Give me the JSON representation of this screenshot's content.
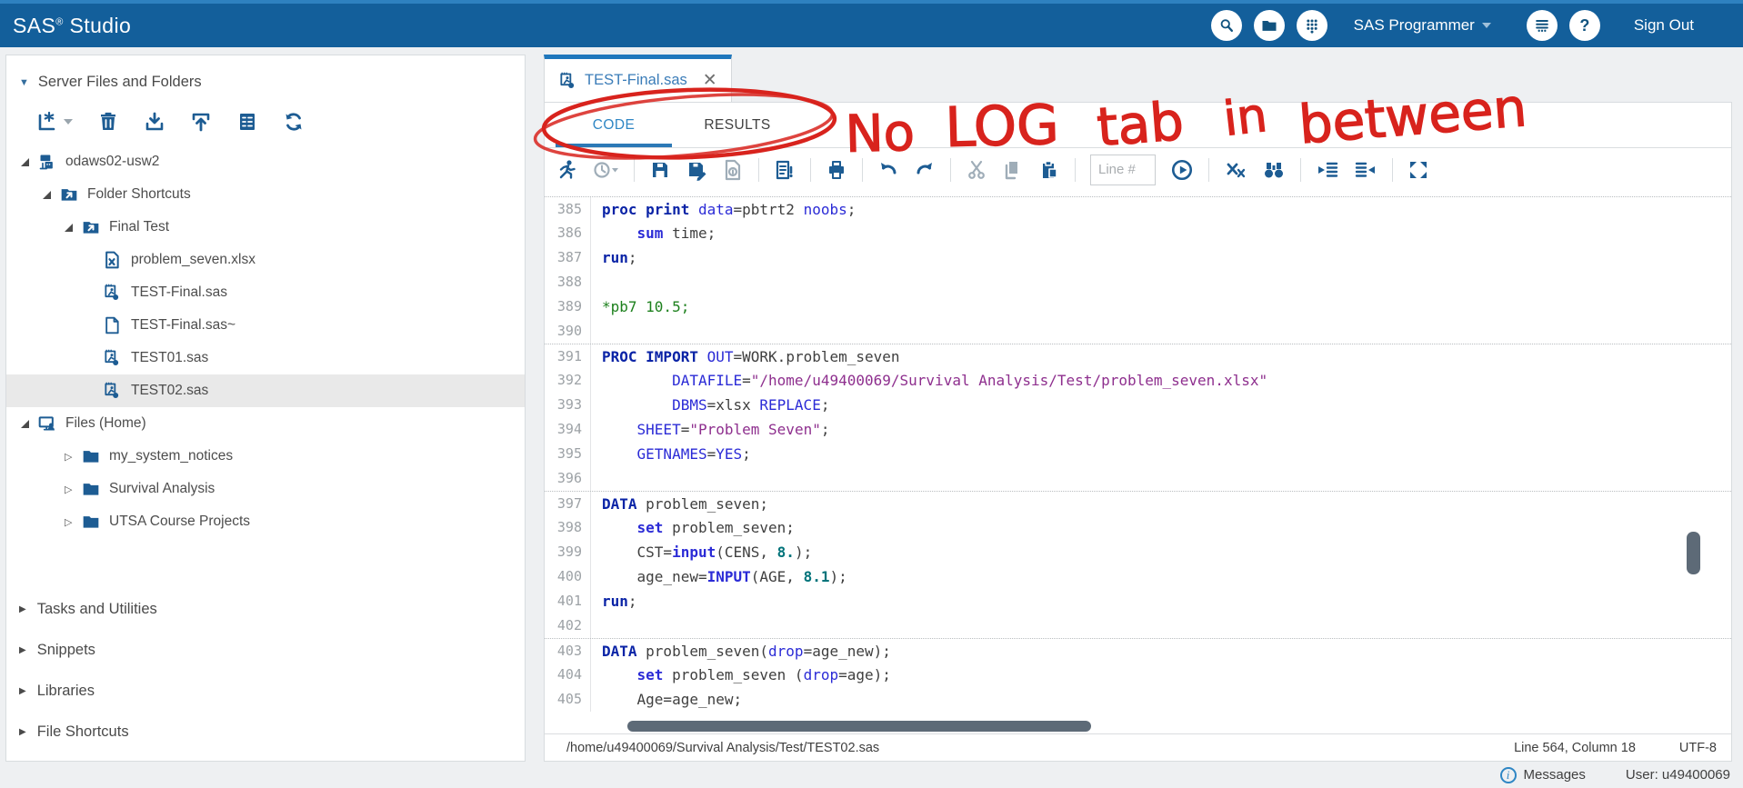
{
  "topbar": {
    "brand_sas": "SAS",
    "brand_reg": "®",
    "brand_studio": " Studio",
    "user_menu": "SAS Programmer",
    "sign_out": "Sign Out",
    "help_glyph": "?"
  },
  "sidebar": {
    "header": "Server Files and Folders",
    "toolbar_icons": [
      "new-item-icon",
      "delete-icon",
      "download-icon",
      "upload-icon",
      "properties-icon",
      "refresh-icon"
    ],
    "tree": [
      {
        "label": "odaws02-usw2",
        "level": 0,
        "caret": "expanded",
        "icon": "server-icon",
        "selected": false
      },
      {
        "label": "Folder Shortcuts",
        "level": 1,
        "caret": "expanded",
        "icon": "shortcut-folder-icon",
        "selected": false
      },
      {
        "label": "Final Test",
        "level": 2,
        "caret": "expanded",
        "icon": "shortcut-folder-icon",
        "selected": false
      },
      {
        "label": "problem_seven.xlsx",
        "level": 3,
        "caret": "none",
        "icon": "excel-file-icon",
        "selected": false
      },
      {
        "label": "TEST-Final.sas",
        "level": 3,
        "caret": "none",
        "icon": "sas-program-icon",
        "selected": false
      },
      {
        "label": "TEST-Final.sas~",
        "level": 3,
        "caret": "none",
        "icon": "file-icon",
        "selected": false
      },
      {
        "label": "TEST01.sas",
        "level": 3,
        "caret": "none",
        "icon": "sas-program-icon",
        "selected": false
      },
      {
        "label": "TEST02.sas",
        "level": 3,
        "caret": "none",
        "icon": "sas-program-icon",
        "selected": true
      },
      {
        "label": "Files (Home)",
        "level": 0,
        "caret": "expanded",
        "icon": "home-files-icon",
        "selected": false
      },
      {
        "label": "my_system_notices",
        "level": 2,
        "caret": "collapsed",
        "icon": "folder-icon",
        "selected": false
      },
      {
        "label": "Survival Analysis",
        "level": 2,
        "caret": "collapsed",
        "icon": "folder-icon",
        "selected": false
      },
      {
        "label": "UTSA Course Projects",
        "level": 2,
        "caret": "collapsed",
        "icon": "folder-icon",
        "selected": false
      }
    ],
    "sections": [
      "Tasks and Utilities",
      "Snippets",
      "Libraries",
      "File Shortcuts"
    ]
  },
  "main": {
    "doc_tab": "TEST-Final.sas",
    "view_tabs": [
      "CODE",
      "RESULTS"
    ],
    "toolbar": {
      "line_input_placeholder": "Line #"
    },
    "editor": {
      "lines": [
        {
          "n": 385,
          "pb": true,
          "seg": [
            [
              "kw",
              "proc print"
            ],
            [
              "pl",
              " "
            ],
            [
              "op",
              "data"
            ],
            [
              "pl",
              "="
            ],
            [
              "pl",
              "pbtrt2 "
            ],
            [
              "op",
              "noobs"
            ],
            [
              "pl",
              ";"
            ]
          ]
        },
        {
          "n": 386,
          "seg": [
            [
              "pl",
              "    "
            ],
            [
              "st",
              "sum"
            ],
            [
              "pl",
              " time;"
            ]
          ]
        },
        {
          "n": 387,
          "seg": [
            [
              "kw",
              "run"
            ],
            [
              "pl",
              ";"
            ]
          ]
        },
        {
          "n": 388,
          "seg": []
        },
        {
          "n": 389,
          "seg": [
            [
              "co",
              "*pb7 10.5;"
            ]
          ]
        },
        {
          "n": 390,
          "seg": []
        },
        {
          "n": 391,
          "pb": true,
          "seg": [
            [
              "kw",
              "PROC IMPORT"
            ],
            [
              "pl",
              " "
            ],
            [
              "op",
              "OUT"
            ],
            [
              "pl",
              "=WORK.problem_seven"
            ]
          ]
        },
        {
          "n": 392,
          "seg": [
            [
              "pl",
              "        "
            ],
            [
              "op",
              "DATAFILE"
            ],
            [
              "pl",
              "="
            ],
            [
              "sr",
              "\"/home/u49400069/Survival Analysis/Test/problem_seven.xlsx\""
            ]
          ]
        },
        {
          "n": 393,
          "seg": [
            [
              "pl",
              "        "
            ],
            [
              "op",
              "DBMS"
            ],
            [
              "pl",
              "=xlsx "
            ],
            [
              "op",
              "REPLACE"
            ],
            [
              "pl",
              ";"
            ]
          ]
        },
        {
          "n": 394,
          "seg": [
            [
              "pl",
              "    "
            ],
            [
              "op",
              "SHEET"
            ],
            [
              "pl",
              "="
            ],
            [
              "sr",
              "\"Problem Seven\""
            ],
            [
              "pl",
              ";"
            ]
          ]
        },
        {
          "n": 395,
          "seg": [
            [
              "pl",
              "    "
            ],
            [
              "op",
              "GETNAMES"
            ],
            [
              "pl",
              "="
            ],
            [
              "op",
              "YES"
            ],
            [
              "pl",
              ";"
            ]
          ]
        },
        {
          "n": 396,
          "seg": []
        },
        {
          "n": 397,
          "pb": true,
          "seg": [
            [
              "kw",
              "DATA"
            ],
            [
              "pl",
              " problem_seven;"
            ]
          ]
        },
        {
          "n": 398,
          "seg": [
            [
              "pl",
              "    "
            ],
            [
              "st",
              "set"
            ],
            [
              "pl",
              " problem_seven;"
            ]
          ]
        },
        {
          "n": 399,
          "seg": [
            [
              "pl",
              "    CST="
            ],
            [
              "st",
              "input"
            ],
            [
              "pl",
              "(CENS, "
            ],
            [
              "nu",
              "8."
            ],
            [
              "pl",
              ");"
            ]
          ]
        },
        {
          "n": 400,
          "seg": [
            [
              "pl",
              "    age_new="
            ],
            [
              "st",
              "INPUT"
            ],
            [
              "pl",
              "(AGE, "
            ],
            [
              "nu",
              "8.1"
            ],
            [
              "pl",
              ");"
            ]
          ]
        },
        {
          "n": 401,
          "seg": [
            [
              "kw",
              "run"
            ],
            [
              "pl",
              ";"
            ]
          ]
        },
        {
          "n": 402,
          "seg": []
        },
        {
          "n": 403,
          "pb": true,
          "seg": [
            [
              "kw",
              "DATA"
            ],
            [
              "pl",
              " problem_seven("
            ],
            [
              "op",
              "drop"
            ],
            [
              "pl",
              "=age_new);"
            ]
          ]
        },
        {
          "n": 404,
          "seg": [
            [
              "pl",
              "    "
            ],
            [
              "st",
              "set"
            ],
            [
              "pl",
              " problem_seven ("
            ],
            [
              "op",
              "drop"
            ],
            [
              "pl",
              "=age);"
            ]
          ]
        },
        {
          "n": 405,
          "seg": [
            [
              "pl",
              "    Age=age_new;"
            ]
          ]
        }
      ]
    },
    "statusbar": {
      "path": "/home/u49400069/Survival Analysis/Test/TEST02.sas",
      "position": "Line 564, Column 18",
      "encoding": "UTF-8"
    }
  },
  "footer": {
    "messages": "Messages",
    "user": "User: u49400069"
  },
  "annotation": {
    "text": "No LOG tab in between",
    "words": [
      "No",
      "LOG",
      "tab",
      "in",
      "between"
    ],
    "color": "#d8231d"
  },
  "colors": {
    "topbar_blue": "#135f9b",
    "accent_blue": "#2e86c4",
    "icon_navy": "#1d5c93",
    "annotation_red": "#d8231d",
    "syntax": {
      "step_keyword": "#0a23a6",
      "statement": "#2b2bd6",
      "option": "#2b2bd6",
      "string": "#8e2f8e",
      "comment": "#1d801d",
      "number_format": "#00737a",
      "plain": "#3f3f3f"
    }
  }
}
